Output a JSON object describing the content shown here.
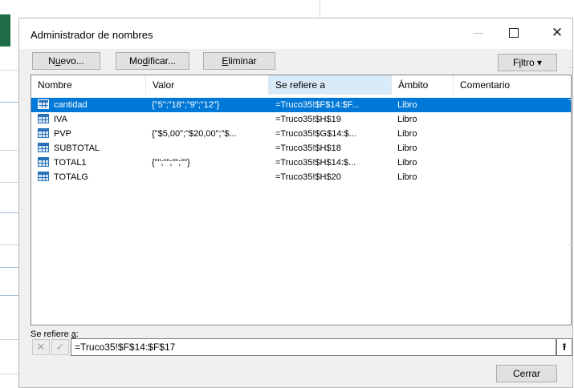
{
  "dialog": {
    "title": "Administrador de nombres",
    "close_glyph": "✕"
  },
  "toolbar": {
    "nuevo_pre": "N",
    "nuevo_mn": "u",
    "nuevo_post": "evo...",
    "modificar_pre": "Mo",
    "modificar_mn": "d",
    "modificar_post": "ificar...",
    "eliminar_pre": "",
    "eliminar_mn": "E",
    "eliminar_post": "liminar",
    "filtro_pre": "F",
    "filtro_mn": "i",
    "filtro_post": "ltro ▾"
  },
  "list": {
    "headers": [
      "Nombre",
      "Valor",
      "Se refiere a",
      "Ámbito",
      "Comentario"
    ],
    "rows": [
      {
        "name": "cantidad",
        "value": "{\"5\";\"18\";\"9\";\"12\"}",
        "refers": "=Truco35!$F$14:$F...",
        "scope": "Libro",
        "comment": ""
      },
      {
        "name": "IVA",
        "value": "",
        "refers": "=Truco35!$H$19",
        "scope": "Libro",
        "comment": ""
      },
      {
        "name": "PVP",
        "value": "{\"$5,00\";\"$20,00\";\"$...",
        "refers": "=Truco35!$G$14:$...",
        "scope": "Libro",
        "comment": ""
      },
      {
        "name": "SUBTOTAL",
        "value": "",
        "refers": "=Truco35!$H$18",
        "scope": "Libro",
        "comment": ""
      },
      {
        "name": "TOTAL1",
        "value": "{\"\";\"\";\"\";\"\"}",
        "refers": "=Truco35!$H$14:$...",
        "scope": "Libro",
        "comment": ""
      },
      {
        "name": "TOTALG",
        "value": "",
        "refers": "=Truco35!$H$20",
        "scope": "Libro",
        "comment": ""
      }
    ],
    "selected_index": 0
  },
  "refers_to": {
    "label_pre": "Se refiere ",
    "label_mn": "a",
    "label_post": ":",
    "value": "=Truco35!$F$14:$F$17",
    "cancel_glyph": "✕",
    "ok_glyph": "✓",
    "collapse_glyph": "⭱"
  },
  "footer": {
    "close_label": "Cerrar"
  },
  "colors": {
    "selection": "#0078d7",
    "sorted_header": "#d9ebf9",
    "excel_green": "#1e6b47"
  }
}
